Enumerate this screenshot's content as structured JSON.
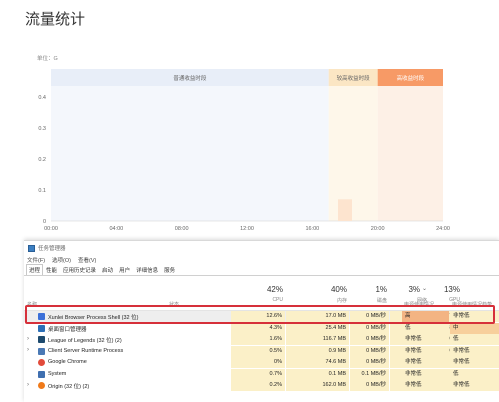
{
  "page": {
    "title": "流量统计",
    "unit_label": "单位：G"
  },
  "chart_data": {
    "type": "bar",
    "title": "流量统计",
    "ylabel": "单位：G",
    "ylim": [
      0,
      0.5
    ],
    "yticks": [
      "0",
      "0.1",
      "0.2",
      "0.3",
      "0.4"
    ],
    "xticks": [
      "00:00",
      "04:00",
      "08:00",
      "12:00",
      "16:00",
      "20:00",
      "24:00"
    ],
    "bands": [
      {
        "name": "普通收益时段",
        "from": "00:00",
        "to": "17:00",
        "color": "#e8eef8"
      },
      {
        "name": "较高收益时段",
        "from": "17:00",
        "to": "20:00",
        "color": "#fbe6c4"
      },
      {
        "name": "高收益时段",
        "from": "20:00",
        "to": "24:00",
        "color": "#f79a66"
      }
    ],
    "band_text_colors": [
      "#666666",
      "#666666",
      "#ffffff"
    ],
    "series": [
      {
        "x": "18:00",
        "value": 0.07
      }
    ]
  },
  "taskmgr": {
    "title": "任务管理器",
    "menus": [
      "文件(F)",
      "选项(O)",
      "查看(V)"
    ],
    "tabs": [
      "进程",
      "性能",
      "应用历史记录",
      "启动",
      "用户",
      "详细信息",
      "服务"
    ],
    "active_tab": "进程",
    "headers": {
      "name": "名称",
      "status": "状态",
      "cpu": {
        "pct": "42%",
        "label": "CPU"
      },
      "mem": {
        "pct": "40%",
        "label": "内存"
      },
      "disk": {
        "pct": "1%",
        "label": "磁盘"
      },
      "net": {
        "pct": "3%",
        "label": "网络"
      },
      "gpu": {
        "pct": "13%",
        "label": "GPU"
      },
      "power": "电源使用情况",
      "power_trend": "电源使用情况趋势"
    },
    "rows": [
      {
        "name": "Xunlei Browser Process Shell (32 位)",
        "icon": "xunlei-icon",
        "expandable": false,
        "cpu": "12.6%",
        "mem": "17.0 MB",
        "disk": "0 MB/秒",
        "net": "0 Mbps",
        "gpu": "7.8%",
        "power": "高",
        "trend": "非常低",
        "highlight": true
      },
      {
        "name": "桌面窗口管理器",
        "icon": "desktop-window-icon",
        "expandable": false,
        "cpu": "4.3%",
        "mem": "25.4 MB",
        "disk": "0 MB/秒",
        "net": "0 Mbps",
        "gpu": "3.3%",
        "power": "低",
        "trend": "中"
      },
      {
        "name": "League of Legends (32 位) (2)",
        "icon": "lol-icon",
        "expandable": true,
        "cpu": "1.6%",
        "mem": "116.7 MB",
        "disk": "0 MB/秒",
        "net": "0 Mbps",
        "gpu": "0.6%",
        "power": "非常低",
        "trend": "低"
      },
      {
        "name": "Client Server Runtime Process",
        "icon": "system-process-icon",
        "expandable": true,
        "cpu": "0.5%",
        "mem": "0.9 MB",
        "disk": "0 MB/秒",
        "net": "0 Mbps",
        "gpu": "0.6%",
        "power": "非常低",
        "trend": "非常低"
      },
      {
        "name": "Google Chrome",
        "icon": "chrome-icon",
        "expandable": false,
        "cpu": "0%",
        "mem": "74.6 MB",
        "disk": "0 MB/秒",
        "net": "0 Mbps",
        "gpu": "0%",
        "power": "非常低",
        "trend": "非常低"
      },
      {
        "name": "System",
        "icon": "system-icon",
        "expandable": false,
        "cpu": "0.7%",
        "mem": "0.1 MB",
        "disk": "0.1 MB/秒",
        "net": "0.1 Mbps",
        "gpu": "0%",
        "power": "非常低",
        "trend": "低"
      },
      {
        "name": "Origin (32 位) (2)",
        "icon": "origin-icon",
        "expandable": true,
        "cpu": "0.2%",
        "mem": "162.0 MB",
        "disk": "0 MB/秒",
        "net": "0 Mbps",
        "gpu": "0%",
        "power": "非常低",
        "trend": "非常低"
      }
    ]
  }
}
